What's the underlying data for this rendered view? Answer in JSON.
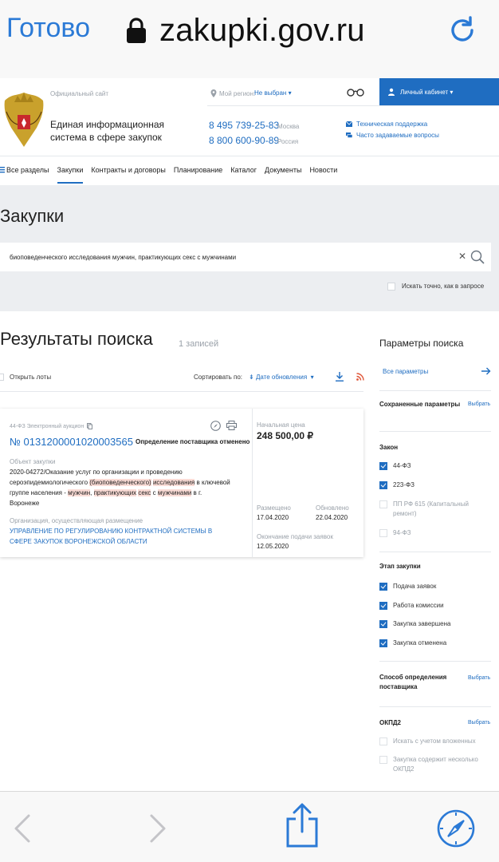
{
  "browser": {
    "done_label": "Готово",
    "url": "zakupki.gov.ru"
  },
  "header": {
    "official_site": "Официальный сайт",
    "region_label": "Мой регион:",
    "region_value": "Не выбран",
    "cabinet_label": "Личный кабинет",
    "system_name": "Единая информационная система в сфере закупок",
    "phone1": "8 495 739-25-83",
    "phone1_city": "Москва",
    "phone2": "8 800 600-90-89",
    "phone2_city": "Россия",
    "support_link": "Техническая поддержка",
    "faq_link": "Часто задаваемые вопросы"
  },
  "nav": {
    "items": [
      "Все разделы",
      "Закупки",
      "Контракты и договоры",
      "Планирование",
      "Каталог",
      "Документы",
      "Новости"
    ],
    "active": "Закупки"
  },
  "search": {
    "heading": "Закупки",
    "query": "биоповеденческого исследования мужчин, практикующих секс с мужчинами",
    "exact_label": "Искать точно, как в запросе"
  },
  "results": {
    "heading": "Результаты поиска",
    "count_label": "1 записей",
    "open_lots": "Открыть лоты",
    "sort_label": "Сортировать по:",
    "sort_value": "Дате обновления"
  },
  "card": {
    "law": "44-ФЗ Электронный аукцион",
    "number": "№ 0131200001020003565",
    "stage": "Определение поставщика отменено",
    "object_label": "Объект закупки",
    "object_parts": [
      {
        "t": "2020-04272/Оказание услуг по организации и проведению сероэпидемиологического ",
        "hl": false
      },
      {
        "t": "(биоповеденческого)",
        "hl": true
      },
      {
        "t": " ",
        "hl": false
      },
      {
        "t": "исследования",
        "hl": true
      },
      {
        "t": " в ключевой группе населения - ",
        "hl": false
      },
      {
        "t": "мужчин",
        "hl": true
      },
      {
        "t": ", ",
        "hl": false
      },
      {
        "t": "практикующих",
        "hl": true
      },
      {
        "t": " ",
        "hl": false
      },
      {
        "t": "секс",
        "hl": true
      },
      {
        "t": " с ",
        "hl": false
      },
      {
        "t": "мужчинами",
        "hl": true
      },
      {
        "t": " в г. Воронеже",
        "hl": false
      }
    ],
    "org_label": "Организация, осуществляющая размещение",
    "org_name": "УПРАВЛЕНИЕ ПО РЕГУЛИРОВАНИЮ КОНТРАКТНОЙ СИСТЕМЫ В СФЕРЕ ЗАКУПОК ВОРОНЕЖСКОЙ ОБЛАСТИ",
    "price_label": "Начальная цена",
    "price": "248 500,00 ₽",
    "posted_label": "Размещено",
    "posted": "17.04.2020",
    "updated_label": "Обновлено",
    "updated": "22.04.2020",
    "end_label": "Окончание подачи заявок",
    "end": "12.05.2020"
  },
  "sidebar": {
    "heading": "Параметры поиска",
    "all_params": "Все параметры",
    "saved_params": "Сохраненные параметры",
    "choose": "Выбрать",
    "law_heading": "Закон",
    "laws": [
      {
        "label": "44-ФЗ",
        "checked": true
      },
      {
        "label": "223-ФЗ",
        "checked": true
      },
      {
        "label": "ПП РФ 615 (Капитальный ремонт)",
        "checked": false
      },
      {
        "label": "94-ФЗ",
        "checked": false
      }
    ],
    "stage_heading": "Этап закупки",
    "stages": [
      {
        "label": "Подача заявок",
        "checked": true
      },
      {
        "label": "Работа комиссии",
        "checked": true
      },
      {
        "label": "Закупка завершена",
        "checked": true
      },
      {
        "label": "Закупка отменена",
        "checked": true
      }
    ],
    "method_heading": "Способ определения поставщика",
    "okpd_heading": "ОКПД2",
    "okpd_opts": [
      {
        "label": "Искать с учетом вложенных",
        "checked": false
      },
      {
        "label": "Закупка содержит несколько ОКПД2",
        "checked": false
      }
    ]
  },
  "colors": {
    "accent": "#1f6dc1",
    "highlight": "#fbdcd6",
    "ios_blue": "#2b7ad6"
  }
}
